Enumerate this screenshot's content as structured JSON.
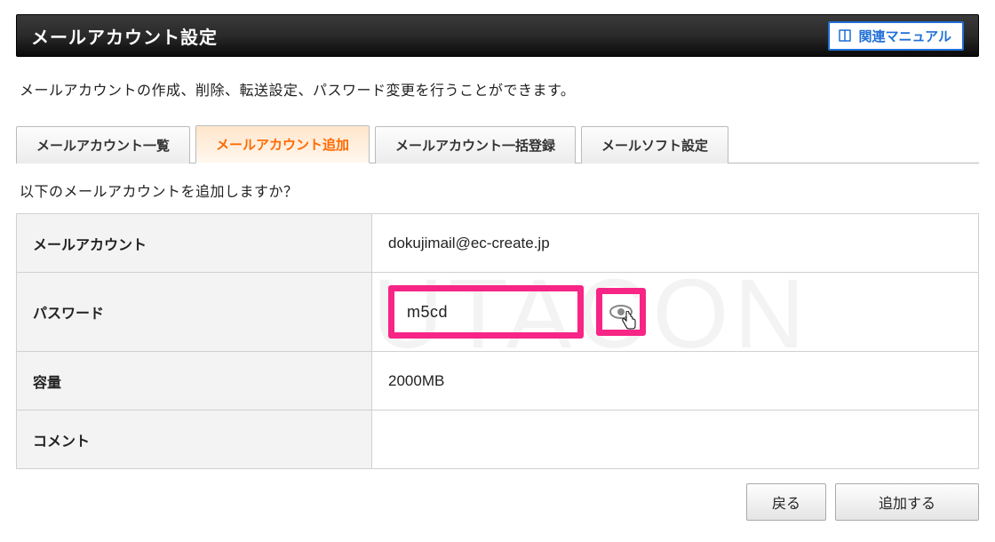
{
  "header": {
    "title": "メールアカウント設定",
    "manual_button": "関連マニュアル"
  },
  "description": "メールアカウントの作成、削除、転送設定、パスワード変更を行うことができます。",
  "tabs": {
    "list": "メールアカウント一覧",
    "add": "メールアカウント追加",
    "bulk": "メールアカウント一括登録",
    "soft": "メールソフト設定"
  },
  "confirm_text": "以下のメールアカウントを追加しますか？",
  "form": {
    "account_label": "メールアカウント",
    "account_value": "dokujimail@ec-create.jp",
    "password_label": "パスワード",
    "password_visible": "m5cd",
    "capacity_label": "容量",
    "capacity_value": "2000MB",
    "comment_label": "コメント",
    "comment_value": ""
  },
  "buttons": {
    "back": "戻る",
    "submit": "追加する"
  },
  "watermark": "YUTACON"
}
